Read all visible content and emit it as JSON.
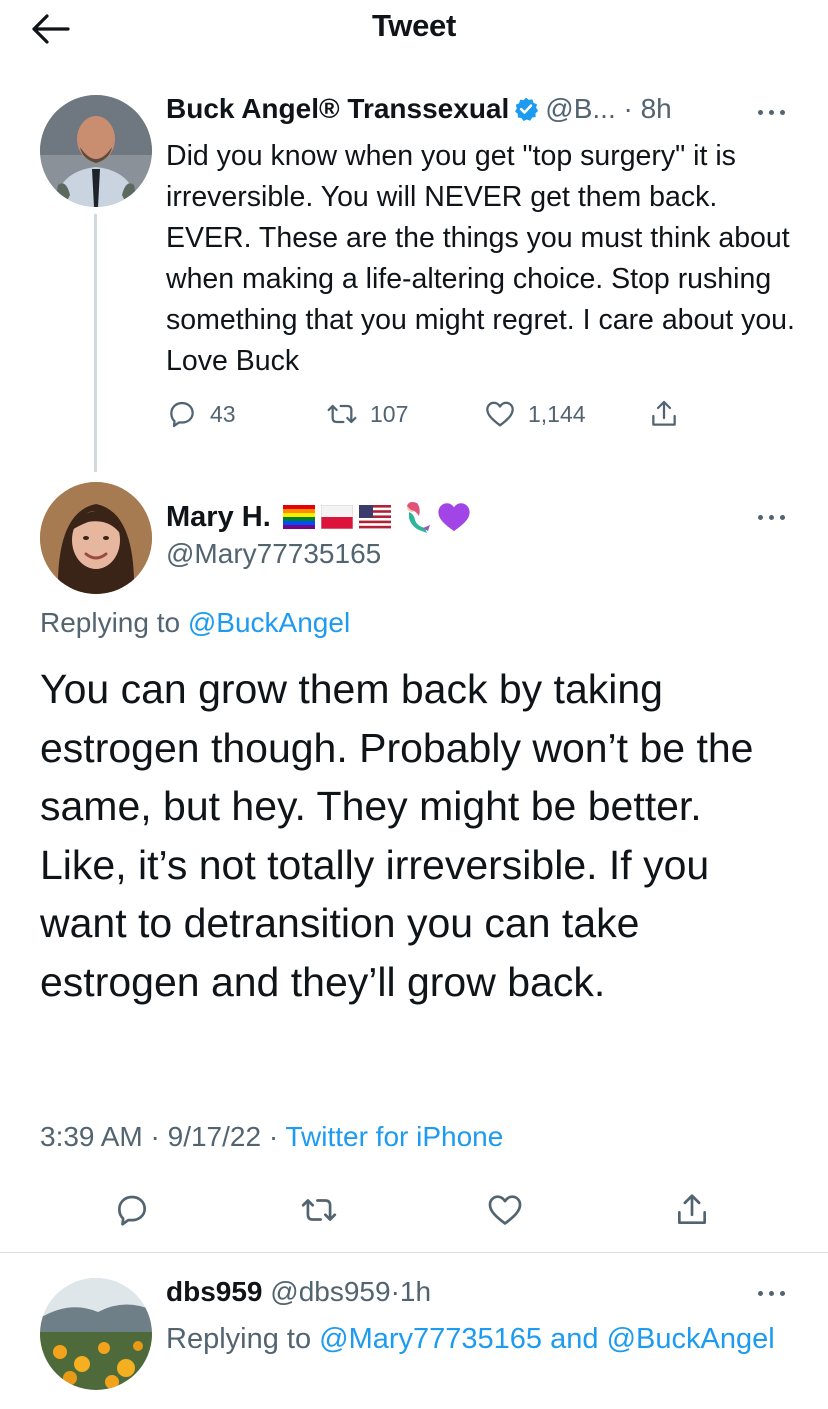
{
  "header": {
    "title": "Tweet"
  },
  "tweet1": {
    "author_name": "Buck Angel® Transsexual",
    "handle": "@B...",
    "separator": "·",
    "time": "8h",
    "text": "Did you know when you get \"top surgery\" it is irreversible. You will NEVER get them back. EVER. These are the things you must think about when making a life-altering choice. Stop rushing something that you might regret. I care about you. Love Buck",
    "replies": "43",
    "retweets": "107",
    "likes": "1,144"
  },
  "tweet2": {
    "author_name": "Mary H.",
    "handle": "@Mary77735165",
    "emoji_icons": [
      "rainbow-flag-icon",
      "poland-flag-icon",
      "us-flag-icon",
      "mermaid-icon",
      "purple-heart-icon"
    ],
    "replying_label": "Replying to",
    "replying_to": "@BuckAngel",
    "text": "You can grow them back by taking estrogen though. Probably won’t be the same, but hey. They might be better. Like, it’s not totally irreversible. If you want to detransition you can take estrogen and they’ll grow back.",
    "time": "3:39 AM",
    "date": "9/17/22",
    "separator": "·",
    "source": "Twitter for iPhone"
  },
  "tweet3": {
    "author_name": "dbs959",
    "handle": "@dbs959",
    "separator": "·",
    "time": "1h",
    "replying_label": "Replying to",
    "replying_to_1": "@Mary77735165",
    "and_label": "and",
    "replying_to_2": "@BuckAngel"
  },
  "colors": {
    "accent": "#1d9bf0",
    "muted": "#536471",
    "text": "#0f1419",
    "divider": "#cfd9de"
  }
}
